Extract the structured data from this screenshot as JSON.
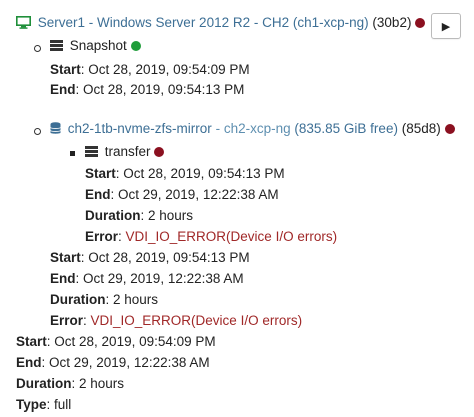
{
  "vm": {
    "name": "Server1 - Windows Server 2012 R2 - CH2",
    "host": "(ch1-xcp-ng)",
    "id": "(30b2)",
    "status_color": "#8b1020",
    "run_button_glyph": "▶",
    "icon": "monitor-icon"
  },
  "snapshot": {
    "label": "Snapshot",
    "status_color": "#1f9d3a",
    "icon": "server-icon",
    "start_label": "Start",
    "start_value": "Oct 28, 2019, 09:54:09 PM",
    "end_label": "End",
    "end_value": "Oct 28, 2019, 09:54:13 PM"
  },
  "sr": {
    "name": "ch2-1tb-nvme-zfs-mirror",
    "host": "ch2-xcp-ng",
    "free": "(835.85 GiB free)",
    "id": "(85d8)",
    "status_color": "#8b1020",
    "icon": "database-icon",
    "transfer": {
      "label": "transfer",
      "icon": "server-icon",
      "status_color": "#8b1020",
      "start_label": "Start",
      "start_value": "Oct 28, 2019, 09:54:13 PM",
      "end_label": "End",
      "end_value": "Oct 29, 2019, 12:22:38 AM",
      "duration_label": "Duration",
      "duration_value": "2 hours",
      "error_label": "Error",
      "error_value": "VDI_IO_ERROR(Device I/O errors)"
    },
    "start_label": "Start",
    "start_value": "Oct 28, 2019, 09:54:13 PM",
    "end_label": "End",
    "end_value": "Oct 29, 2019, 12:22:38 AM",
    "duration_label": "Duration",
    "duration_value": "2 hours",
    "error_label": "Error",
    "error_value": "VDI_IO_ERROR(Device I/O errors)"
  },
  "summary": {
    "start_label": "Start",
    "start_value": "Oct 28, 2019, 09:54:09 PM",
    "end_label": "End",
    "end_value": "Oct 29, 2019, 12:22:38 AM",
    "duration_label": "Duration",
    "duration_value": "2 hours",
    "type_label": "Type",
    "type_value": "full"
  }
}
